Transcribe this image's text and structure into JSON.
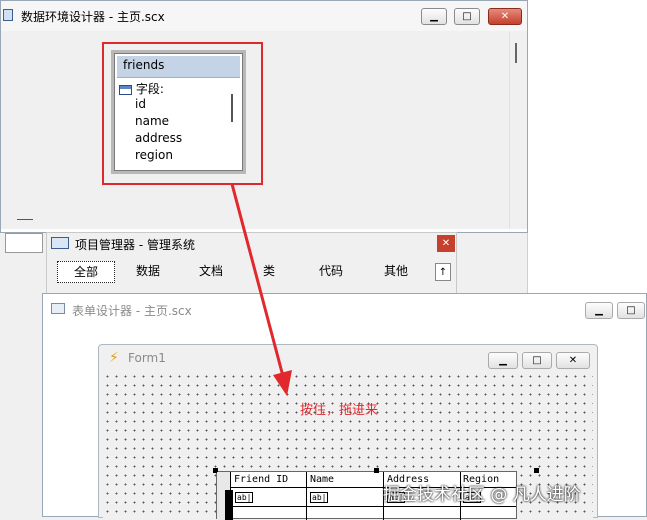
{
  "data_env_window": {
    "title": "数据环境设计器 - 主页.scx",
    "table_box": {
      "name": "friends",
      "fields_label": "字段:",
      "fields": [
        "id",
        "name",
        "address",
        "region"
      ]
    }
  },
  "project_manager": {
    "title": "项目管理器 - 管理系统",
    "tabs": [
      "全部",
      "数据",
      "文档",
      "类",
      "代码",
      "其他"
    ],
    "active_tab": "全部"
  },
  "form_designer": {
    "title": "表单设计器 - 主页.scx",
    "form_title": "Form1",
    "annotation": "按住，拖进来",
    "grid_headers": [
      "Friend ID",
      "Name",
      "Address",
      "Region"
    ],
    "cell_icon_text": "ab|"
  },
  "watermark": "掘金技术社区 @ 凡人进阶",
  "colors": {
    "highlight_red": "#e0282d",
    "arrow_red": "#e0282d",
    "close_button": "#c5412d"
  }
}
